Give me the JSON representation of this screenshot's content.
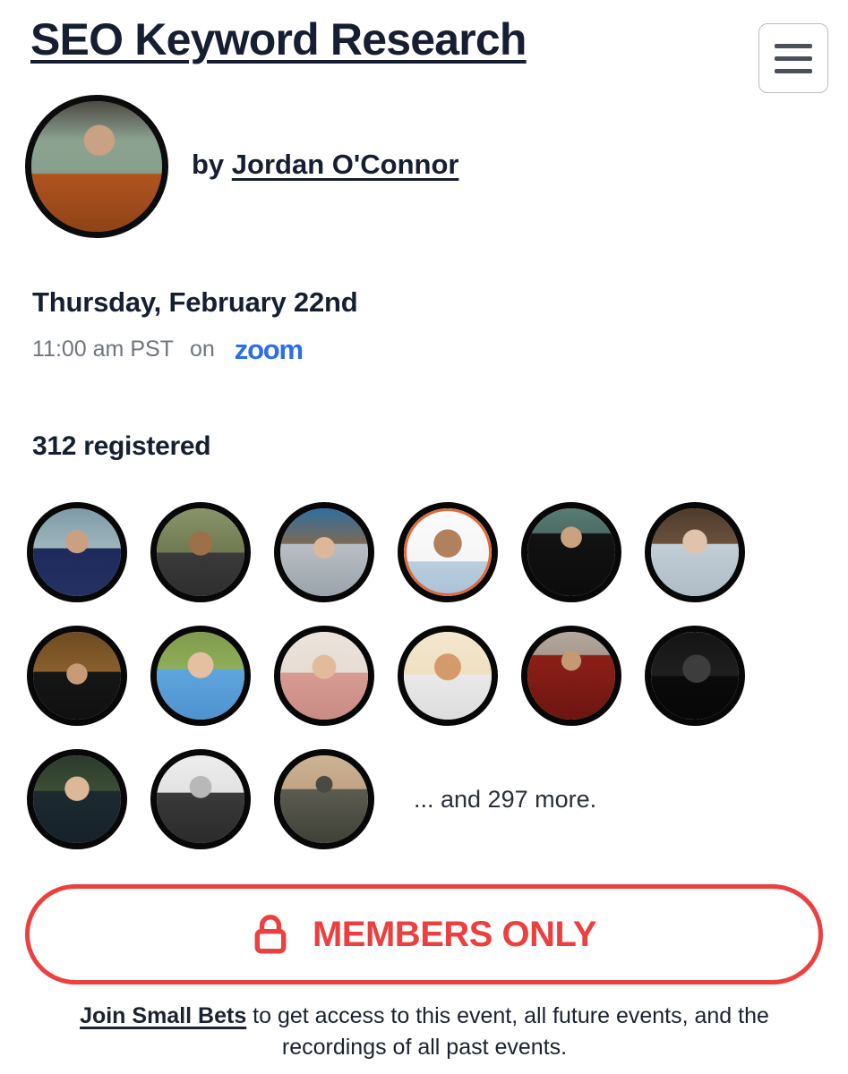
{
  "header": {
    "title": "SEO Keyword Research",
    "menu_icon": "hamburger-icon"
  },
  "author": {
    "prefix": "by ",
    "name": "Jordan O'Connor",
    "avatar_alt": "jordan-oconnor-avatar"
  },
  "event": {
    "date": "Thursday, February 22nd",
    "time": "11:00 am PST",
    "on_word": "on",
    "platform": "zoom"
  },
  "registration": {
    "count_label": "312 registered",
    "more_label": "... and 297 more.",
    "avatars": [
      {
        "name": "attendee-avatar-1",
        "art": "ph-a",
        "highlight": false
      },
      {
        "name": "attendee-avatar-2",
        "art": "ph-b",
        "highlight": false
      },
      {
        "name": "attendee-avatar-3",
        "art": "ph-c",
        "highlight": false
      },
      {
        "name": "attendee-avatar-4",
        "art": "ph-d",
        "highlight": true
      },
      {
        "name": "attendee-avatar-5",
        "art": "ph-e",
        "highlight": false
      },
      {
        "name": "attendee-avatar-6",
        "art": "ph-f",
        "highlight": false
      },
      {
        "name": "attendee-avatar-7",
        "art": "ph-g",
        "highlight": false
      },
      {
        "name": "attendee-avatar-8",
        "art": "ph-h",
        "highlight": false
      },
      {
        "name": "attendee-avatar-9",
        "art": "ph-i",
        "highlight": false
      },
      {
        "name": "attendee-avatar-10",
        "art": "ph-j",
        "highlight": false
      },
      {
        "name": "attendee-avatar-11",
        "art": "ph-k",
        "highlight": false
      },
      {
        "name": "attendee-avatar-12",
        "art": "ph-l",
        "highlight": false
      },
      {
        "name": "attendee-avatar-13",
        "art": "ph-m",
        "highlight": false
      },
      {
        "name": "attendee-avatar-14",
        "art": "ph-n",
        "highlight": false
      },
      {
        "name": "attendee-avatar-15",
        "art": "ph-o",
        "highlight": false
      }
    ]
  },
  "cta": {
    "label": "MEMBERS ONLY",
    "icon": "lock-icon"
  },
  "footer": {
    "link_text": "Join Small Bets",
    "rest_text": " to get access to this event, all future events, and the recordings of all past events."
  },
  "colors": {
    "ink": "#161f32",
    "muted": "#6f757e",
    "zoom_blue": "#2b6dea",
    "cta_red": "#ec4040",
    "ring_black": "#080808",
    "ring_accent": "#e2683a"
  }
}
